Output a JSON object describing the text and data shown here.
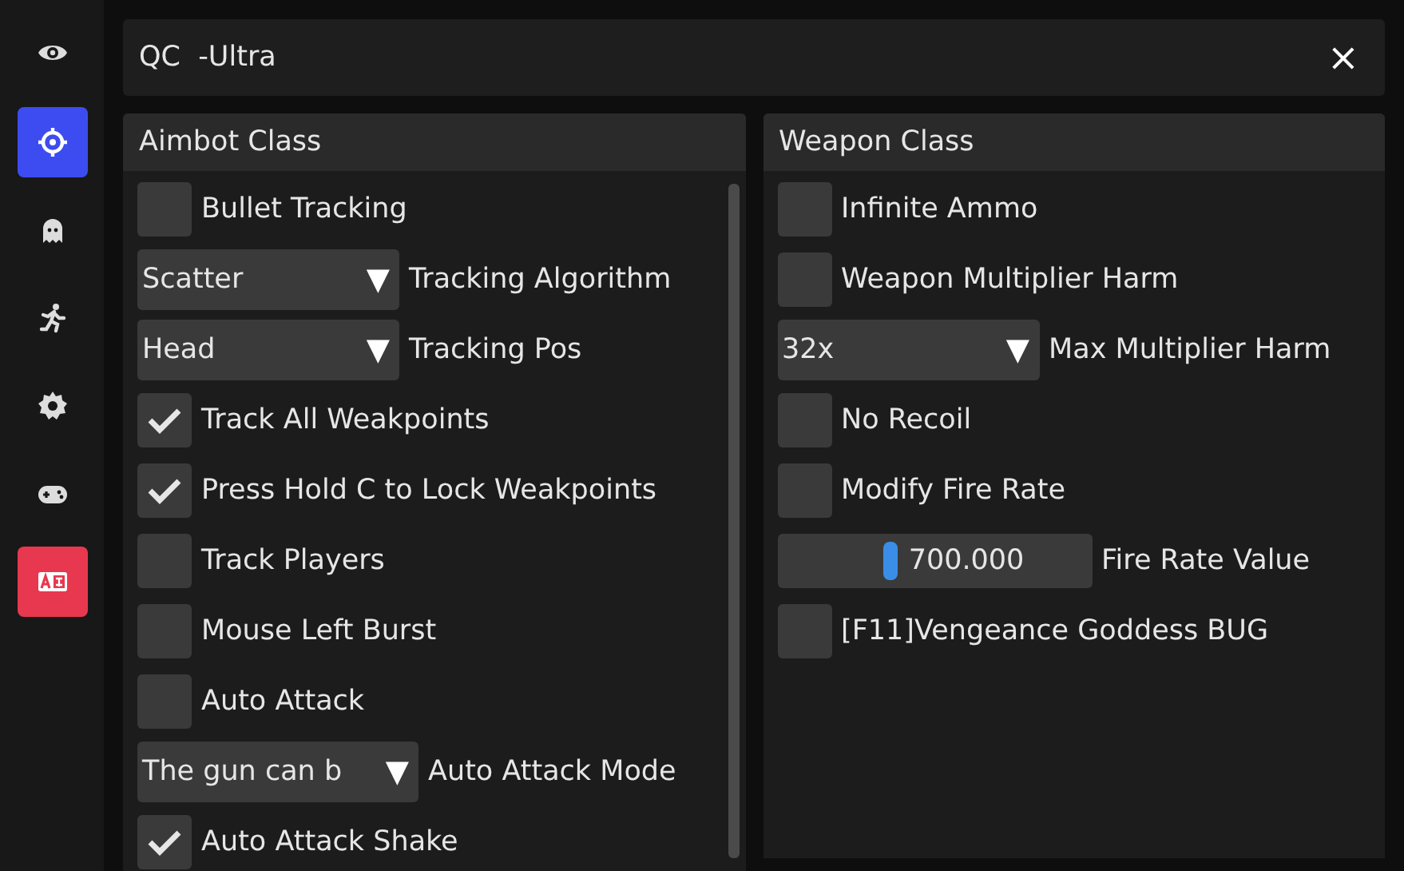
{
  "sidebar": {
    "items": [
      {
        "kind": "tab",
        "selected": false
      },
      {
        "kind": "tab",
        "selected": true
      },
      {
        "kind": "tab",
        "selected": false
      },
      {
        "kind": "tab",
        "selected": false
      },
      {
        "kind": "tab",
        "selected": false
      },
      {
        "kind": "tab",
        "selected": false
      },
      {
        "kind": "accent",
        "selected": false
      }
    ]
  },
  "window": {
    "title": "QC  -Ultra",
    "close": "×"
  },
  "panels": [
    {
      "title": "Aimbot Class",
      "scrollbar": true,
      "items": [
        {
          "kind": "checkbox",
          "label": "Bullet Tracking",
          "checked": false
        },
        {
          "kind": "select",
          "choice": "Scatter",
          "label": "Tracking Algorithm",
          "arrow": "▼"
        },
        {
          "kind": "select",
          "choice": "Head",
          "label": "Tracking Pos",
          "arrow": "▼"
        },
        {
          "kind": "checkbox",
          "label": "Track All Weakpoints",
          "checked": true
        },
        {
          "kind": "checkbox",
          "label": "Press Hold C to Lock Weakpoints",
          "checked": true
        },
        {
          "kind": "checkbox",
          "label": "Track Players",
          "checked": false
        },
        {
          "kind": "checkbox",
          "label": "Mouse Left Burst",
          "checked": false
        },
        {
          "kind": "checkbox",
          "label": "Auto Attack",
          "checked": false
        },
        {
          "kind": "select",
          "choice": "The gun can b",
          "label": "Auto Attack Mode",
          "arrow": "▼",
          "wide": true
        },
        {
          "kind": "checkbox",
          "label": "Auto Attack Shake",
          "checked": true
        }
      ]
    },
    {
      "title": "Weapon Class",
      "scrollbar": false,
      "items": [
        {
          "kind": "checkbox",
          "label": "Infinite Ammo",
          "checked": false
        },
        {
          "kind": "checkbox",
          "label": "Weapon Multiplier Harm",
          "checked": false
        },
        {
          "kind": "select",
          "choice": "32x",
          "label": "Max Multiplier Harm",
          "arrow": "▼"
        },
        {
          "kind": "checkbox",
          "label": "No Recoil",
          "checked": false
        },
        {
          "kind": "checkbox",
          "label": "Modify Fire Rate",
          "checked": false
        },
        {
          "kind": "slider",
          "value": "700.000",
          "label": "Fire Rate Value",
          "level": 0.36
        },
        {
          "kind": "checkbox",
          "label": "[F11]Vengeance Goddess BUG",
          "checked": false
        }
      ]
    }
  ]
}
